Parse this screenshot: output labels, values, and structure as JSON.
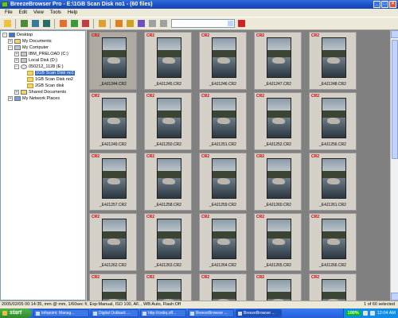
{
  "window": {
    "title": "BreezeBrowser Pro - E:\\1GB Scan Disk no1 - (60 files)",
    "minimize": "_",
    "maximize": "□",
    "close": "×"
  },
  "menu": [
    "File",
    "Edit",
    "View",
    "Tools",
    "Help"
  ],
  "tree": [
    {
      "label": "Desktop",
      "icon": "desktop-icon",
      "expander": "−"
    },
    {
      "label": "My Documents",
      "icon": "folder-icon",
      "expander": "+"
    },
    {
      "label": "My Computer",
      "icon": "computer-icon",
      "expander": "−"
    },
    {
      "label": "IBM_PRELOAD (C:)",
      "icon": "drive-icon",
      "expander": "+"
    },
    {
      "label": "Local Disk (D:)",
      "icon": "drive-icon",
      "expander": "+"
    },
    {
      "label": "050212_1128 (E:)",
      "icon": "cd-icon",
      "expander": "−"
    },
    {
      "label": "1GB Scan Disk no1",
      "icon": "folder-icon",
      "expander": "",
      "selected": true
    },
    {
      "label": "1GB Scan Disk no2",
      "icon": "folder-icon",
      "expander": ""
    },
    {
      "label": "2GB Scan disk",
      "icon": "folder-icon",
      "expander": ""
    },
    {
      "label": "Shared Documents",
      "icon": "folder-icon",
      "expander": "+"
    },
    {
      "label": "My Network Places",
      "icon": "network-icon",
      "expander": "+"
    }
  ],
  "thumbnails": [
    {
      "badge": "CR2",
      "name": "_E4J1244.CR2",
      "selected": true
    },
    {
      "badge": "CR2",
      "name": "_E4J1245.CR2"
    },
    {
      "badge": "CR2",
      "name": "_E4J1246.CR2"
    },
    {
      "badge": "CR2",
      "name": "_E4J1247.CR2"
    },
    {
      "badge": "CR2",
      "name": "_E4J1248.CR2"
    },
    {
      "badge": "CR2",
      "name": "_E4J1249.CR2"
    },
    {
      "badge": "CR2",
      "name": "_E4J1250.CR2"
    },
    {
      "badge": "CR2",
      "name": "_E4J1251.CR2"
    },
    {
      "badge": "CR2",
      "name": "_E4J1252.CR2"
    },
    {
      "badge": "CR2",
      "name": "_E4J1256.CR2"
    },
    {
      "badge": "CR2",
      "name": "_E4J1257.CR2"
    },
    {
      "badge": "CR2",
      "name": "_E4J1258.CR2"
    },
    {
      "badge": "CR2",
      "name": "_E4J1259.CR2"
    },
    {
      "badge": "CR2",
      "name": "_E4J1260.CR2"
    },
    {
      "badge": "CR2",
      "name": "_E4J1261.CR2"
    },
    {
      "badge": "CR2",
      "name": "_E4J1262.CR2"
    },
    {
      "badge": "CR2",
      "name": "_E4J1263.CR2"
    },
    {
      "badge": "CR2",
      "name": "_E4J1264.CR2"
    },
    {
      "badge": "CR2",
      "name": "_E4J1265.CR2"
    },
    {
      "badge": "CR2",
      "name": "_E4J1266.CR2"
    },
    {
      "badge": "CR2",
      "name": ""
    },
    {
      "badge": "CR2",
      "name": ""
    },
    {
      "badge": "CR2",
      "name": ""
    },
    {
      "badge": "CR2",
      "name": ""
    },
    {
      "badge": "CR2",
      "name": ""
    }
  ],
  "status": {
    "left": "2005/02/05 00:14:35, mm @ mm, 1/60sec f/, Exp:Manual, ISO 100, AF, , WB:Auto, Flash:Off",
    "right": "1 of 60 selected"
  },
  "taskbar": {
    "start": "start",
    "tasks": [
      "Infopoint: Manag...",
      "Digital Outback ...",
      "http://csdiq.off...",
      "BreezeBrowser ...",
      "BreezeBrowser ..."
    ],
    "zoom": "100%",
    "clock": "12:04 AM"
  },
  "colors": {
    "titlebar": "#1b4ec3",
    "selection": "#316ac5",
    "raw_badge": "#d40000",
    "start": "#2f8a2a"
  }
}
